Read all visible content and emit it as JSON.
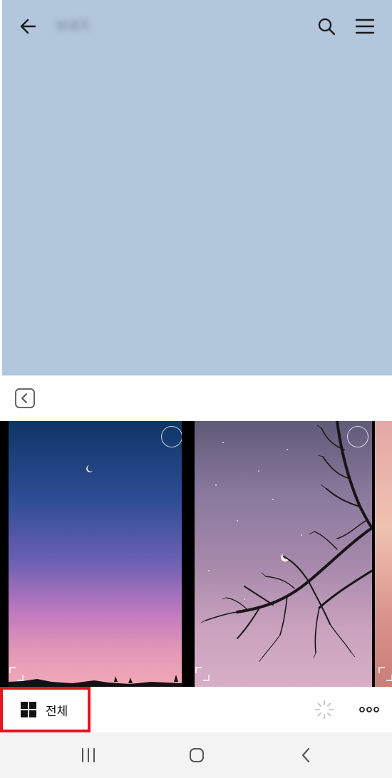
{
  "header": {
    "chat_title": "보내기",
    "back_icon": "arrow-left-icon",
    "search_icon": "search-icon",
    "menu_icon": "hamburger-menu-icon"
  },
  "colors": {
    "preview_bg": "#b2c6dc",
    "highlight": "#e8141c",
    "navbar_bg": "#f3f3f3"
  },
  "gallery": {
    "collapse_icon": "chevron-left-box-icon",
    "photos": [
      {
        "name": "dusk-crescent-moon-photo"
      },
      {
        "name": "tree-silhouette-night-sky-photo"
      },
      {
        "name": "pink-partial-photo"
      }
    ]
  },
  "toolbar": {
    "all_label": "전체",
    "grid_icon": "grid-icon",
    "loader_icon": "loading-spinner-icon",
    "more_icon": "more-dots-icon"
  },
  "navbar": {
    "recents_icon": "recent-apps-icon",
    "home_icon": "home-icon",
    "back_icon": "nav-back-icon"
  }
}
